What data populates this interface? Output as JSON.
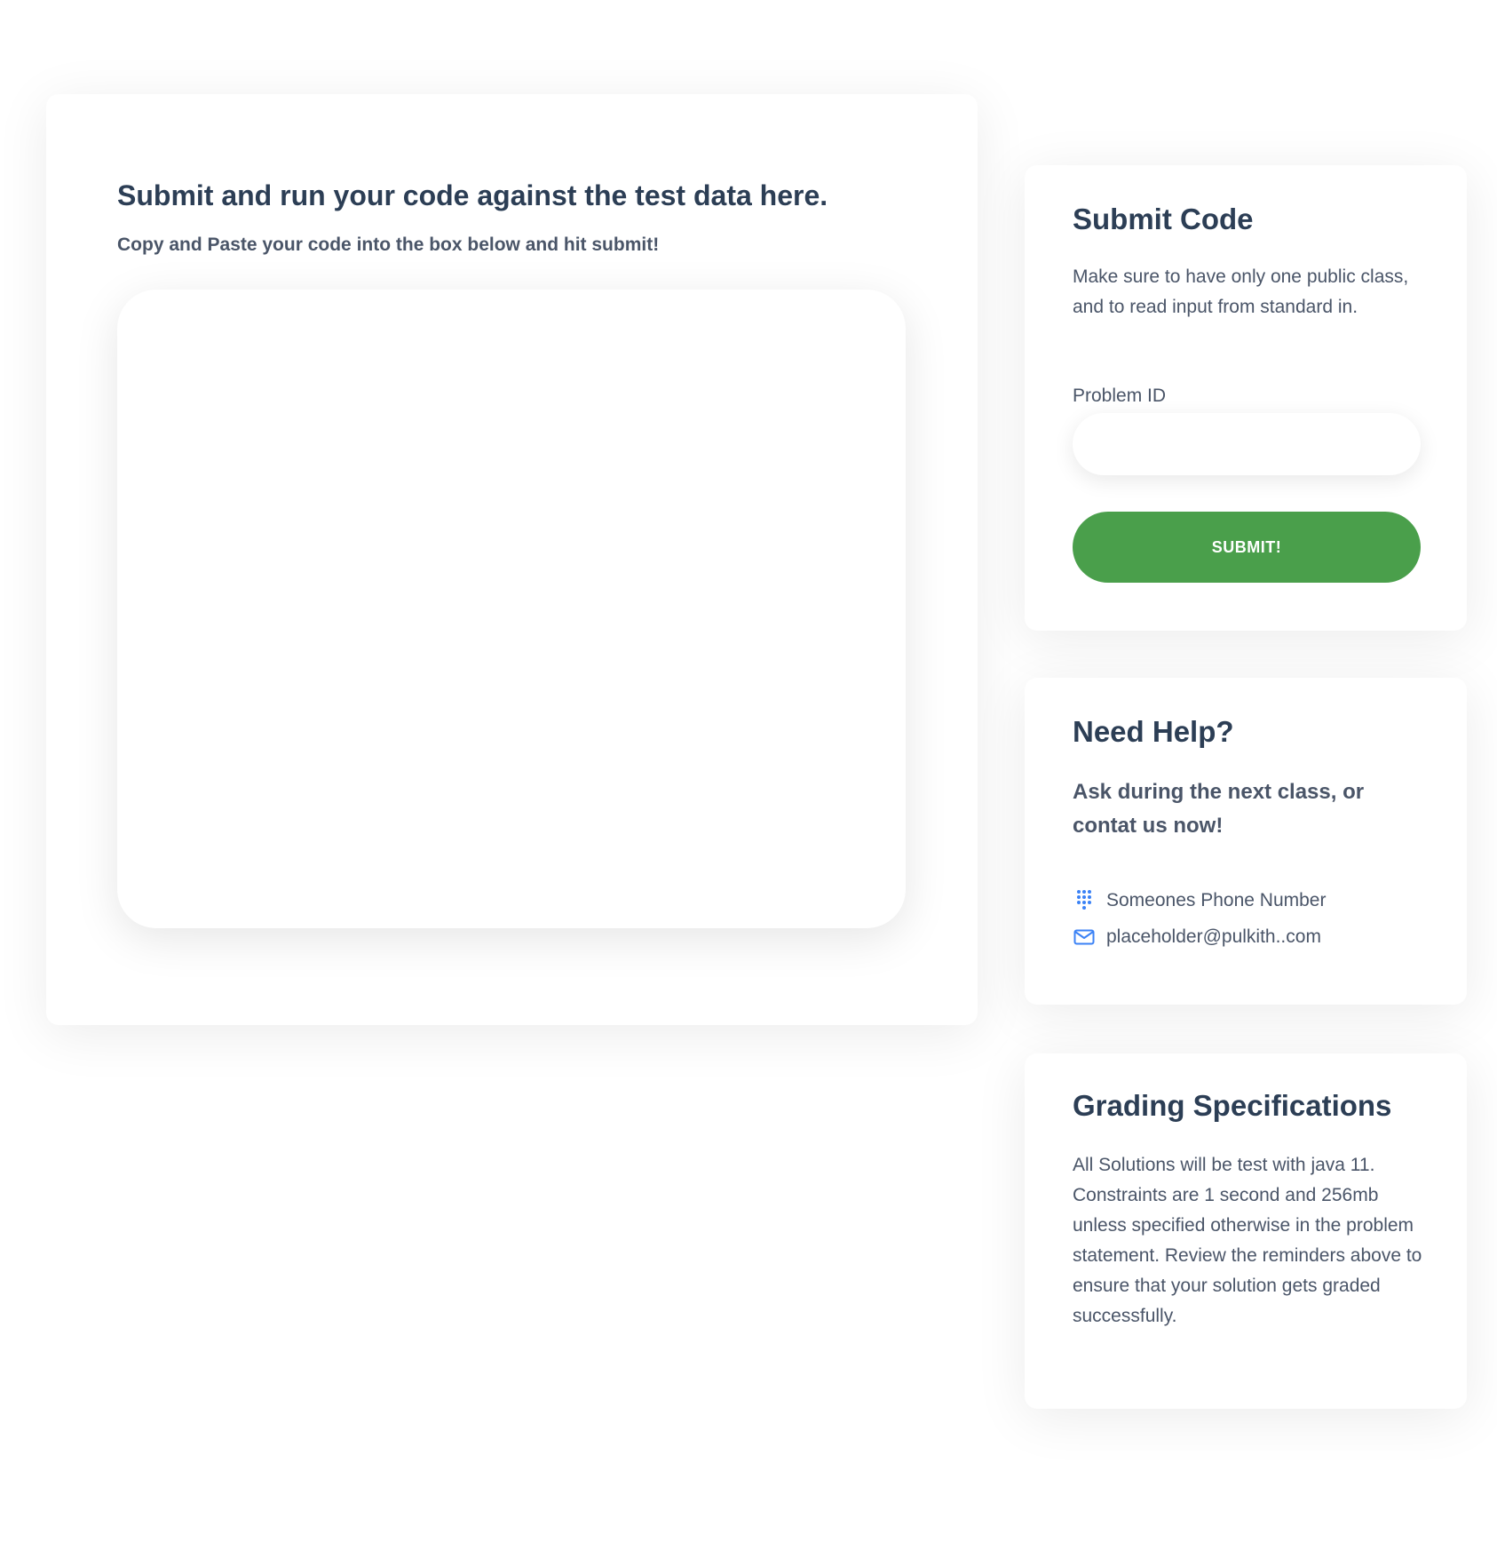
{
  "main": {
    "title": "Submit and run your code against the test data here.",
    "subtitle": "Copy and Paste your code into the box below and hit submit!",
    "code_value": ""
  },
  "submit_card": {
    "title": "Submit Code",
    "description": "Make sure to have only one public class, and to read input from standard in.",
    "problem_id_label": "Problem ID",
    "problem_id_value": "",
    "button_label": "SUBMIT!",
    "button_color": "#4a9f4b"
  },
  "help_card": {
    "title": "Need Help?",
    "lead": "Ask during the next class, or contat us now!",
    "phone": {
      "icon": "dialpad-icon",
      "text": "Someones Phone Number"
    },
    "email": {
      "icon": "mail-icon",
      "text": "placeholder@pulkith..com"
    },
    "icon_color": "#3b82f6"
  },
  "grading_card": {
    "title": "Grading Specifications",
    "text": "All Solutions will be test with java 11. Constraints are 1 second and 256mb unless specified otherwise in the problem statement. Review the reminders above to ensure that your solution gets graded successfully."
  },
  "colors": {
    "heading": "#2c3e55",
    "body_text": "#4a5568"
  }
}
